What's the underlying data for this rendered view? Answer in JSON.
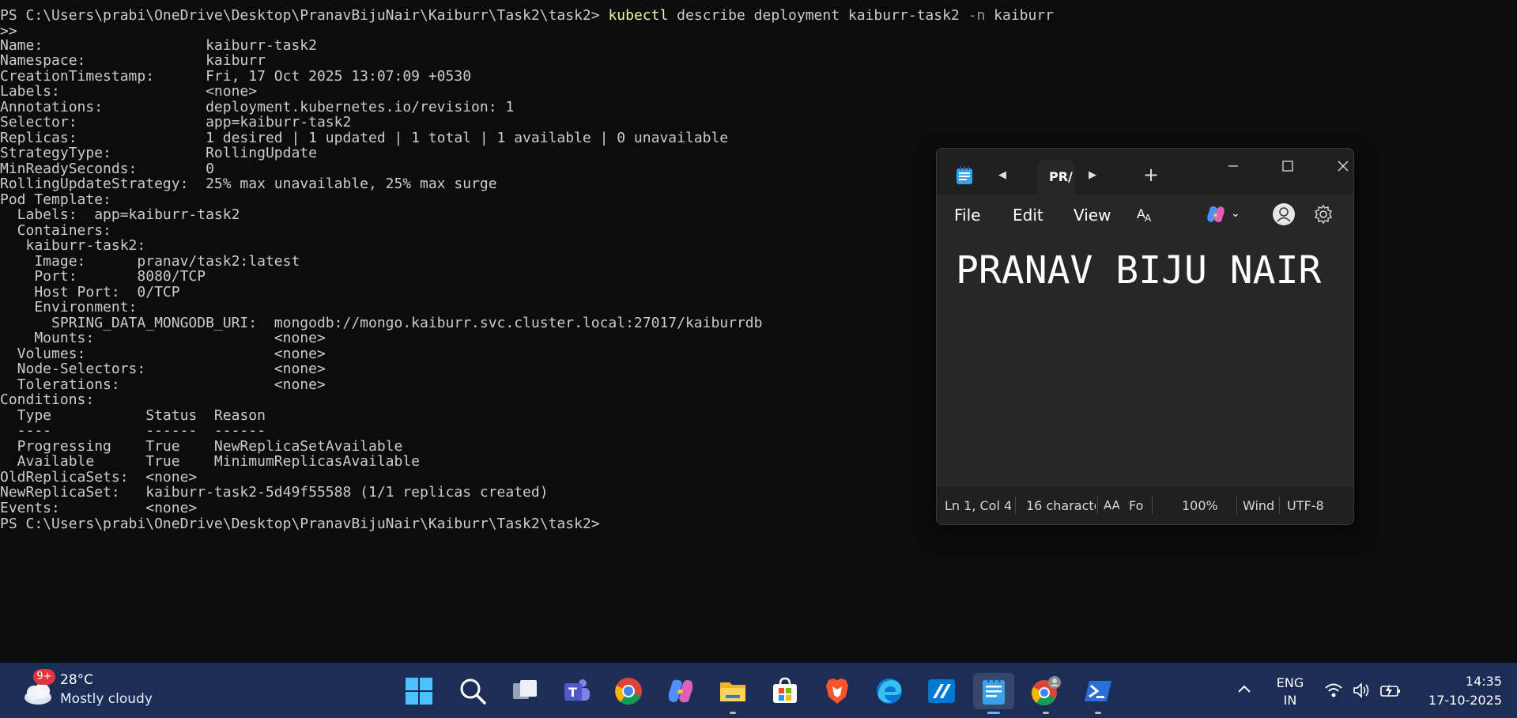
{
  "terminal": {
    "prompt_path": "PS C:\\Users\\prabi\\OneDrive\\Desktop\\PranavBijuNair\\Kaiburr\\Task2\\task2>",
    "command": "kubectl",
    "command_args": "describe deployment kaiburr-task2",
    "flag": "-n",
    "flag_value": "kaiburr",
    "continuation": ">>",
    "output_lines": [
      "Name:                   kaiburr-task2",
      "Namespace:              kaiburr",
      "CreationTimestamp:      Fri, 17 Oct 2025 13:07:09 +0530",
      "Labels:                 <none>",
      "Annotations:            deployment.kubernetes.io/revision: 1",
      "Selector:               app=kaiburr-task2",
      "Replicas:               1 desired | 1 updated | 1 total | 1 available | 0 unavailable",
      "StrategyType:           RollingUpdate",
      "MinReadySeconds:        0",
      "RollingUpdateStrategy:  25% max unavailable, 25% max surge",
      "Pod Template:",
      "  Labels:  app=kaiburr-task2",
      "  Containers:",
      "   kaiburr-task2:",
      "    Image:      pranav/task2:latest",
      "    Port:       8080/TCP",
      "    Host Port:  0/TCP",
      "    Environment:",
      "      SPRING_DATA_MONGODB_URI:  mongodb://mongo.kaiburr.svc.cluster.local:27017/kaiburrdb",
      "    Mounts:                     <none>",
      "  Volumes:                      <none>",
      "  Node-Selectors:               <none>",
      "  Tolerations:                  <none>",
      "Conditions:",
      "  Type           Status  Reason",
      "  ----           ------  ------",
      "  Progressing    True    NewReplicaSetAvailable",
      "  Available      True    MinimumReplicasAvailable",
      "OldReplicaSets:  <none>",
      "NewReplicaSet:   kaiburr-task2-5d49f55588 (1/1 replicas created)",
      "Events:          <none>"
    ],
    "final_prompt": "PS C:\\Users\\prabi\\OneDrive\\Desktop\\PranavBijuNair\\Kaiburr\\Task2\\task2>"
  },
  "notepad": {
    "tab_title": "PR/",
    "menu": [
      "File",
      "Edit",
      "View"
    ],
    "content": "PRANAV BIJU NAIR",
    "status": {
      "position": "Ln 1, Col 4",
      "characters": "16 characte",
      "font": "Fo",
      "zoom": "100%",
      "line_ending": "Wind",
      "encoding": "UTF-8"
    }
  },
  "taskbar": {
    "weather_badge": "9+",
    "temperature": "28°C",
    "condition": "Mostly cloudy",
    "language": "ENG",
    "region": "IN",
    "time": "14:35",
    "date": "17-10-2025",
    "apps": [
      "start-icon",
      "search-icon",
      "task-view-icon",
      "teams-icon",
      "chrome-icon",
      "copilot-icon",
      "file-explorer-icon",
      "store-icon",
      "brave-icon",
      "edge-icon",
      "app-icon",
      "notepad-icon",
      "chrome-profile-icon",
      "powershell-icon"
    ]
  },
  "colors": {
    "terminal_bg": "#0c0c0c",
    "terminal_text": "#cccccc",
    "command": "#f9f1a5",
    "taskbar_bg": "#1c2d56",
    "notepad_bg": "#272727"
  }
}
